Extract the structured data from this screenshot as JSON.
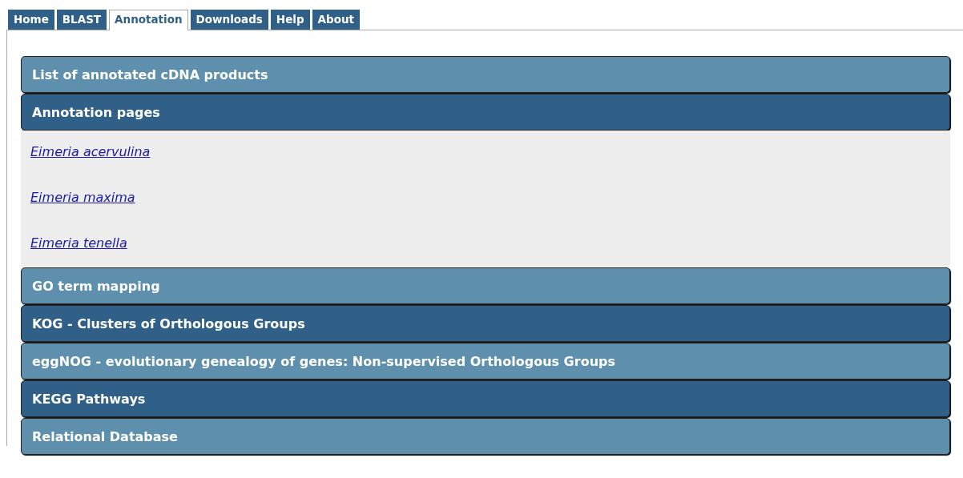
{
  "tabs": [
    {
      "label": "Home",
      "selected": false
    },
    {
      "label": "BLAST",
      "selected": false
    },
    {
      "label": "Annotation",
      "selected": true
    },
    {
      "label": "Downloads",
      "selected": false
    },
    {
      "label": "Help",
      "selected": false
    },
    {
      "label": "About",
      "selected": false
    }
  ],
  "sections": [
    {
      "title": "List of annotated cDNA products",
      "kind": "light",
      "expanded": false
    },
    {
      "title": "Annotation pages",
      "kind": "dark",
      "expanded": true,
      "links": [
        "Eimeria acervulina",
        "Eimeria maxima",
        "Eimeria tenella"
      ]
    },
    {
      "title": "GO term mapping",
      "kind": "light",
      "expanded": false
    },
    {
      "title": "KOG - Clusters of Orthologous Groups",
      "kind": "dark",
      "expanded": false
    },
    {
      "title": "eggNOG - evolutionary genealogy of genes: Non-supervised Orthologous Groups",
      "kind": "light",
      "expanded": false
    },
    {
      "title": "KEGG Pathways",
      "kind": "dark",
      "expanded": false
    },
    {
      "title": "Relational Database",
      "kind": "light",
      "expanded": false
    }
  ]
}
